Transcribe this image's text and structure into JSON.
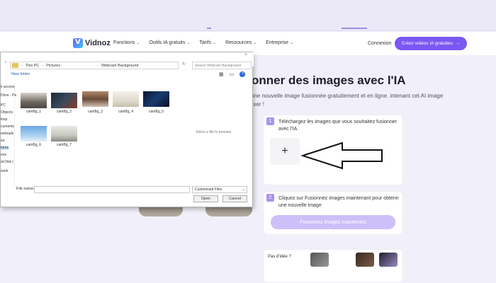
{
  "site": {
    "logo_text": "Vidnoz",
    "nav": [
      {
        "label": "Fonctions"
      },
      {
        "label": "Outils IA gratuits"
      },
      {
        "label": "Tarifs"
      },
      {
        "label": "Ressources"
      },
      {
        "label": "Entreprise"
      }
    ],
    "login_label": "Connexion",
    "cta_label": "Créez vidéos IA gratuites",
    "cta_arrow": "→",
    "accent_color": "#7b57f2"
  },
  "hero": {
    "title": "onner des images avec l'IA",
    "description": "r une nouvelle image fusionnée gratuitement et en ligne. intenant cet AI image mixer !"
  },
  "steps": [
    {
      "number": "1",
      "text": "Téléchargez les images que vous souhaitez fusionner avec l'IA",
      "upload_symbol": "+"
    },
    {
      "number": "2",
      "text": "Cliquez sur Fusionnez images maintenant pour obtenir une nouvelle image",
      "button_label": "Fusionnez images maintenant"
    }
  ],
  "bottom_card": {
    "label": "Pas d'idée ?"
  },
  "dialog": {
    "breadcrumb": [
      "This PC",
      "Pictures",
      "Webcam Background"
    ],
    "search_placeholder": "Search Webcam Background",
    "new_folder_label": "New folder",
    "help_symbol": "?",
    "sidebar": [
      "k access",
      "Drive - Pe",
      "PC",
      "Objects",
      "ktop",
      "cuments",
      "wnloads",
      "sic",
      "tures",
      "eos",
      "al Disk (",
      "work"
    ],
    "files": [
      {
        "name": "camBg_1"
      },
      {
        "name": "camBg_2"
      },
      {
        "name": "camBg_3"
      },
      {
        "name": "camBg_4"
      },
      {
        "name": "camBg_5"
      },
      {
        "name": "camBg_6"
      },
      {
        "name": "camBg_7"
      }
    ],
    "preview_message": "Select a file to preview.",
    "file_name_label": "File name:",
    "file_name_value": "",
    "file_type_value": "Customised Files",
    "open_label": "Open",
    "cancel_label": "Cancel"
  }
}
